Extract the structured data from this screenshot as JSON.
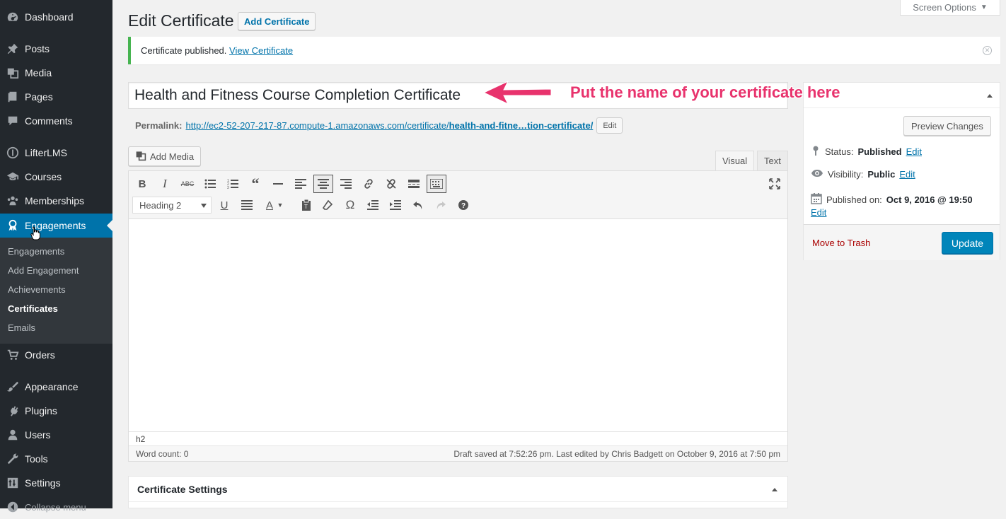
{
  "sidebar": {
    "items": [
      {
        "label": "Dashboard",
        "icon": "dashboard-icon"
      },
      {
        "label": "Posts",
        "icon": "pin-icon"
      },
      {
        "label": "Media",
        "icon": "media-icon"
      },
      {
        "label": "Pages",
        "icon": "pages-icon"
      },
      {
        "label": "Comments",
        "icon": "comments-icon"
      },
      {
        "label": "LifterLMS",
        "icon": "lifterlms-icon"
      },
      {
        "label": "Courses",
        "icon": "courses-icon"
      },
      {
        "label": "Memberships",
        "icon": "memberships-icon"
      },
      {
        "label": "Engagements",
        "icon": "engagements-icon"
      },
      {
        "label": "Orders",
        "icon": "cart-icon"
      },
      {
        "label": "Appearance",
        "icon": "brush-icon"
      },
      {
        "label": "Plugins",
        "icon": "plug-icon"
      },
      {
        "label": "Users",
        "icon": "user-icon"
      },
      {
        "label": "Tools",
        "icon": "wrench-icon"
      },
      {
        "label": "Settings",
        "icon": "settings-icon"
      },
      {
        "label": "Collapse menu",
        "icon": "collapse-icon"
      }
    ],
    "submenu": [
      "Engagements",
      "Add Engagement",
      "Achievements",
      "Certificates",
      "Emails"
    ]
  },
  "header": {
    "title": "Edit Certificate",
    "add_button": "Add Certificate",
    "screen_options": "Screen Options"
  },
  "notice": {
    "text": "Certificate published.",
    "link": "View Certificate"
  },
  "post": {
    "title": "Health and Fitness Course Completion Certificate",
    "permalink_label": "Permalink:",
    "permalink_base": "http://ec2-52-207-217-87.compute-1.amazonaws.com/certificate/",
    "permalink_slug": "health-and-fitne…tion-certificate/",
    "permalink_edit": "Edit"
  },
  "annotation": {
    "text": "Put the name of your certificate here",
    "color": "#e8336d"
  },
  "editor": {
    "add_media": "Add Media",
    "tabs": [
      "Visual",
      "Text"
    ],
    "format_value": "Heading 2",
    "path": "h2",
    "word_count": "Word count: 0",
    "draft_status": "Draft saved at 7:52:26 pm. Last edited by Chris Badgett on October 9, 2016 at 7:50 pm"
  },
  "publish": {
    "preview_button": "Preview Changes",
    "status_label": "Status:",
    "status_value": "Published",
    "visibility_label": "Visibility:",
    "visibility_value": "Public",
    "published_label": "Published on:",
    "published_value": "Oct 9, 2016 @ 19:50",
    "edit_link": "Edit",
    "trash": "Move to Trash",
    "update_button": "Update"
  },
  "cert_settings": {
    "title": "Certificate Settings"
  },
  "colors": {
    "sidebar_bg": "#23282d",
    "accent": "#0073aa",
    "notice_border": "#46b450",
    "primary_button": "#0085ba"
  }
}
